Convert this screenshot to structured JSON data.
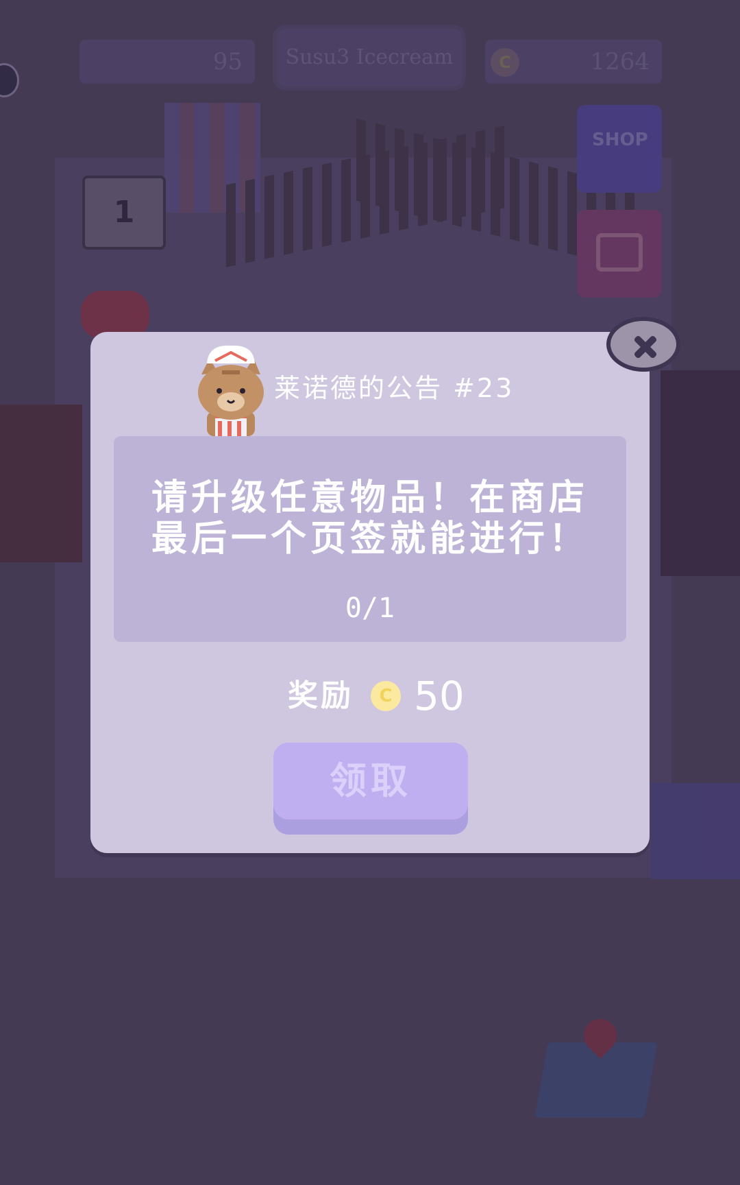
{
  "hud": {
    "left_counter": "95",
    "shop_name": "Susu3 Icecream",
    "coins": "1264",
    "coin_symbol": "C",
    "shop_button_label": "SHOP",
    "calendar_day": "1"
  },
  "dialog": {
    "title": "莱诺德的公告 #23",
    "message_line1": "请升级任意物品！在商店",
    "message_line2": "最后一个页签就能进行！",
    "progress": "0/1",
    "reward_label": "奖励",
    "reward_coin_symbol": "C",
    "reward_amount": "50",
    "claim_label": "领取"
  },
  "colors": {
    "modal_bg": "#cfc6df",
    "message_box_bg": "#bdb3d7",
    "claim_button": "#bfaff0",
    "coin": "#fbe9a0"
  },
  "icons": [
    "close-icon",
    "cat-chef-avatar",
    "coin-icon",
    "shop-cart-icon",
    "gift-chest-icon",
    "map-pin-icon",
    "chat-icon",
    "calendar-icon",
    "gamepad-icon"
  ]
}
